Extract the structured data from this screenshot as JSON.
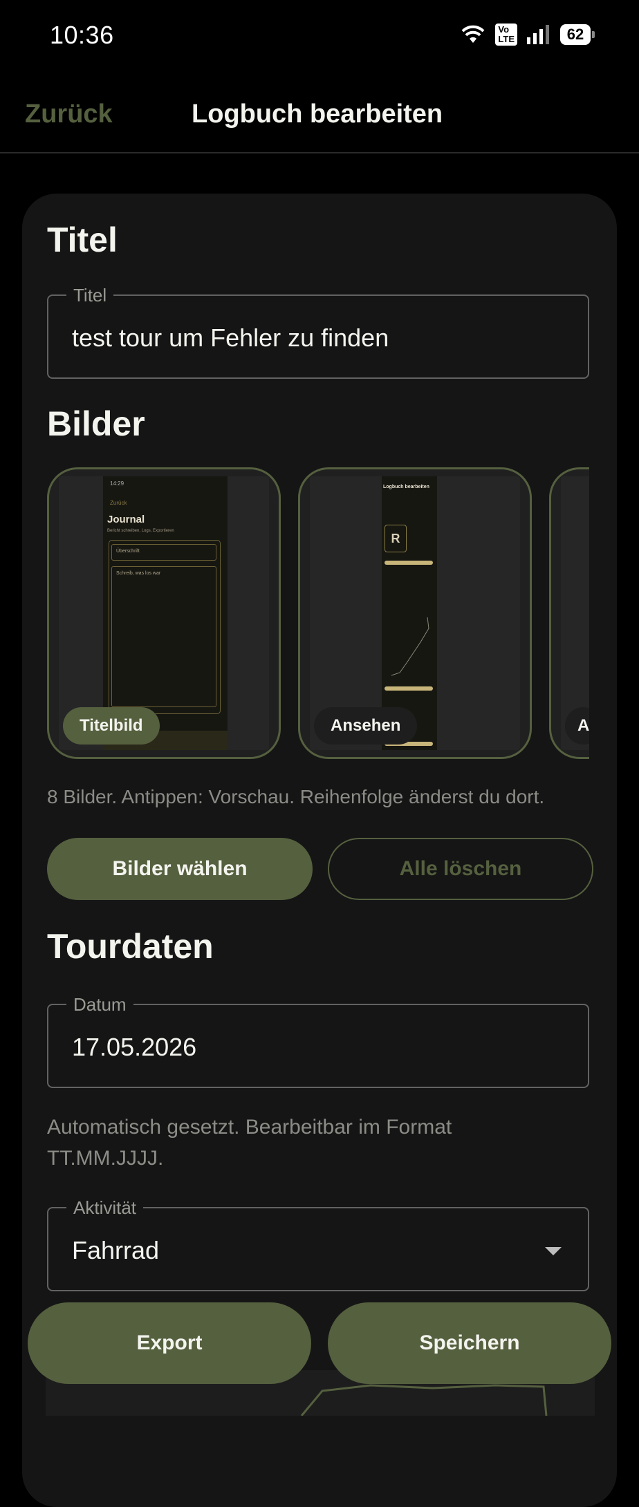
{
  "status": {
    "time": "10:36",
    "network_badge": "Vo\nLTE",
    "battery": "62",
    "icons": [
      "wifi-icon",
      "volte-icon",
      "signal-icon",
      "battery-icon"
    ]
  },
  "header": {
    "back_label": "Zurück",
    "title": "Logbuch bearbeiten"
  },
  "sections": {
    "title_heading": "Titel",
    "images_heading": "Bilder",
    "tour_heading": "Tourdaten"
  },
  "title_field": {
    "label": "Titel",
    "value": "test tour um Fehler zu finden"
  },
  "images": {
    "thumbs": [
      {
        "label": "Titelbild",
        "screen_heading": "Journal",
        "screen_back": "Zurück",
        "screen_subtitle": "Bericht schreiben, Logs, Exportieren",
        "screen_field": "Überschrift",
        "screen_textarea": "Schreib, was los war"
      },
      {
        "label": "Ansehen",
        "screen_heading": "Logbuch bearbeiten"
      },
      {
        "label": "A"
      }
    ],
    "hint": "8 Bilder. Antippen: Vorschau. Reihenfolge änderst du dort.",
    "choose_label": "Bilder wählen",
    "delete_label": "Alle löschen"
  },
  "date_field": {
    "label": "Datum",
    "value": "17.05.2026",
    "hint": "Automatisch gesetzt. Bearbeitbar im Format TT.MM.JJJJ."
  },
  "activity_field": {
    "label": "Aktivität",
    "value": "Fahrrad"
  },
  "actions": {
    "export_label": "Export",
    "save_label": "Speichern"
  },
  "colors": {
    "accent": "#55603f",
    "background": "#000000",
    "card": "#151515",
    "text": "#f4f4ef"
  }
}
